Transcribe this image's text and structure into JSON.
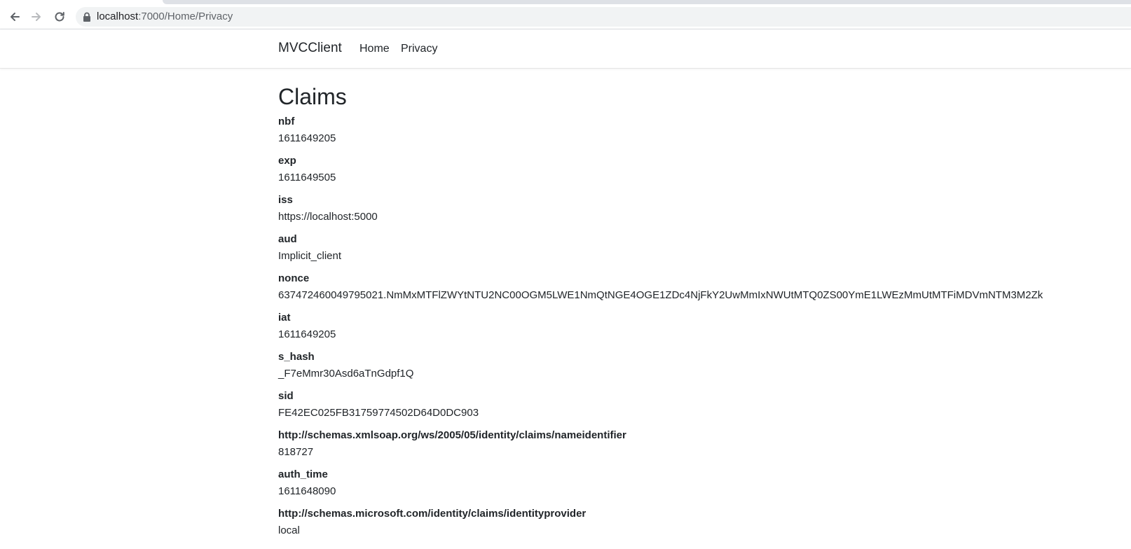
{
  "browser": {
    "url_host": "localhost",
    "url_rest": ":7000/Home/Privacy"
  },
  "navbar": {
    "brand": "MVCClient",
    "links": [
      {
        "label": "Home"
      },
      {
        "label": "Privacy"
      }
    ]
  },
  "page": {
    "title": "Claims"
  },
  "claims": [
    {
      "type": "nbf",
      "value": "1611649205"
    },
    {
      "type": "exp",
      "value": "1611649505"
    },
    {
      "type": "iss",
      "value": "https://localhost:5000"
    },
    {
      "type": "aud",
      "value": "Implicit_client"
    },
    {
      "type": "nonce",
      "value": "637472460049795021.NmMxMTFlZWYtNTU2NC00OGM5LWE1NmQtNGE4OGE1ZDc4NjFkY2UwMmIxNWUtMTQ0ZS00YmE1LWEzMmUtMTFiMDVmNTM3M2Zk"
    },
    {
      "type": "iat",
      "value": "1611649205"
    },
    {
      "type": "s_hash",
      "value": "_F7eMmr30Asd6aTnGdpf1Q"
    },
    {
      "type": "sid",
      "value": "FE42EC025FB31759774502D64D0DC903"
    },
    {
      "type": "http://schemas.xmlsoap.org/ws/2005/05/identity/claims/nameidentifier",
      "value": "818727"
    },
    {
      "type": "auth_time",
      "value": "1611648090"
    },
    {
      "type": "http://schemas.microsoft.com/identity/claims/identityprovider",
      "value": "local"
    }
  ]
}
